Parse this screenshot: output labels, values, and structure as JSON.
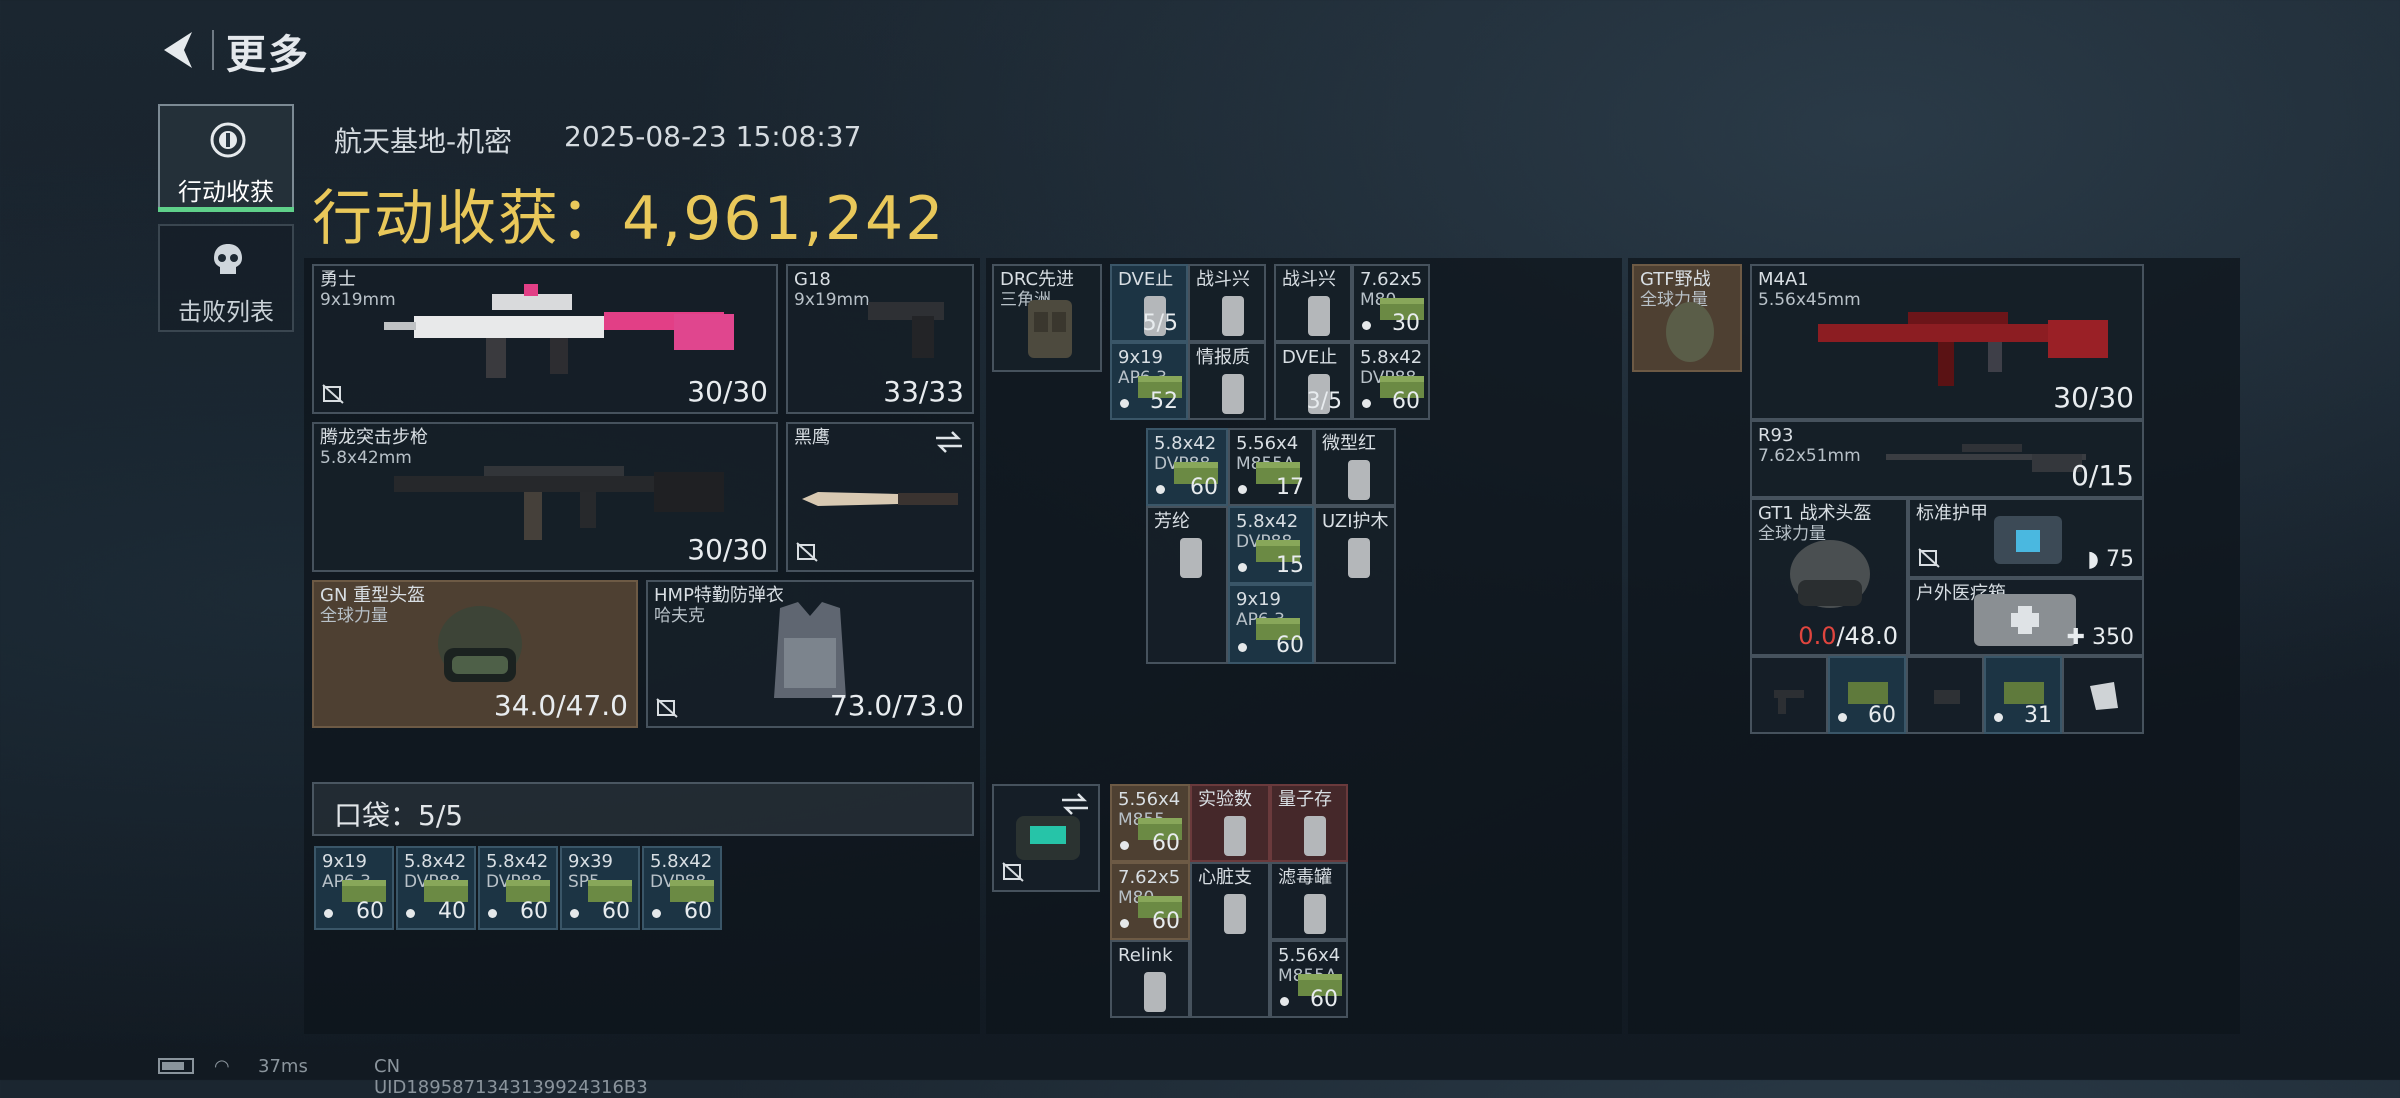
{
  "header": {
    "back_label": "back",
    "title": "更多"
  },
  "tabs": [
    {
      "label": "行动收获",
      "icon": "medal-icon",
      "active": true
    },
    {
      "label": "击败列表",
      "icon": "skull-icon",
      "active": false
    }
  ],
  "raid": {
    "map": "航天基地-机密",
    "datetime": "2025-08-23 15:08:37",
    "total_label": "行动收获：",
    "total_value": "4,961,242"
  },
  "loadout": {
    "primary": {
      "name": "勇士",
      "ammo": "9x19mm",
      "count": "30/30"
    },
    "secondary_pistol": {
      "name": "G18",
      "ammo": "9x19mm",
      "count": "33/33"
    },
    "primary2": {
      "name": "腾龙突击步枪",
      "ammo": "5.8x42mm",
      "count": "30/30"
    },
    "melee": {
      "name": "黑鹰"
    },
    "helmet": {
      "name": "GN 重型头盔",
      "brand": "全球力量",
      "durability": "34.0/47.0"
    },
    "armor": {
      "name": "HMP特勤防弹衣",
      "brand": "哈夫克",
      "durability": "73.0/73.0"
    },
    "pocket_label": "口袋：5/5",
    "pocket_items": [
      {
        "l1": "9x19",
        "l2": "AP6.3",
        "count": "60"
      },
      {
        "l1": "5.8x42",
        "l2": "DVP88",
        "count": "40"
      },
      {
        "l1": "5.8x42",
        "l2": "DVP88",
        "count": "60"
      },
      {
        "l1": "9x39",
        "l2": "SP5",
        "count": "60"
      },
      {
        "l1": "5.8x42",
        "l2": "DVP88",
        "count": "60"
      }
    ]
  },
  "backpack": {
    "rig": {
      "l1": "DRC先进",
      "l2": "三角洲"
    },
    "rig_items": [
      {
        "l1": "DVE止",
        "count": "5/5"
      },
      {
        "l1": "战斗兴"
      },
      {
        "l1": "战斗兴"
      },
      {
        "l1": "7.62x5",
        "l2": "M80",
        "count": "30"
      },
      {
        "l1": "9x19",
        "l2": "AP6.3",
        "count": "52"
      },
      {
        "l1": "情报质"
      },
      {
        "l1": "DVE止",
        "count": "3/5"
      },
      {
        "l1": "5.8x42",
        "l2": "DVP88",
        "count": "60"
      },
      {
        "l1": "5.8x42",
        "l2": "DVP88",
        "count": "60"
      },
      {
        "l1": "5.56x4",
        "l2": "M855A",
        "count": "17"
      },
      {
        "l1": "微型红"
      },
      {
        "l1": "芳纶"
      },
      {
        "l1": "5.8x42",
        "l2": "DVP88",
        "count": "15"
      },
      {
        "l1": "UZI护木"
      },
      {
        "l1": "9x19",
        "l2": "AP6.3",
        "count": "60"
      }
    ],
    "bag_items": [
      {
        "l1": "5.56x4",
        "l2": "M855",
        "count": "60"
      },
      {
        "l1": "实验数"
      },
      {
        "l1": "量子存"
      },
      {
        "l1": "7.62x5",
        "l2": "M80",
        "count": "60"
      },
      {
        "l1": "心脏支"
      },
      {
        "l1": "滤毒罐"
      },
      {
        "l1": "Relink"
      },
      {
        "l1": "5.56x4",
        "l2": "M855A",
        "count": "60"
      }
    ]
  },
  "enemy": {
    "rig": {
      "l1": "GTF野战",
      "l2": "全球力量"
    },
    "primary": {
      "name": "M4A1",
      "ammo": "5.56x45mm",
      "count": "30/30"
    },
    "secondary": {
      "name": "R93",
      "ammo": "7.62x51mm",
      "count": "0/15"
    },
    "helmet": {
      "name": "GT1 战术头盔",
      "brand": "全球力量",
      "durability_current": "0.0",
      "durability_max": "/48.0"
    },
    "armor": {
      "name": "标准护甲",
      "value": "75"
    },
    "med": {
      "name": "户外医疗箱",
      "value": "350"
    },
    "bottom_counts": {
      "c1": "60",
      "c2": "31"
    }
  },
  "status": {
    "ping": "37ms",
    "uid": "CN UID1895871343139924316B3"
  },
  "colors": {
    "accent_gold": "#e9c85a",
    "tab_active": "#5fd08a",
    "durability_low": "#e0453e"
  }
}
